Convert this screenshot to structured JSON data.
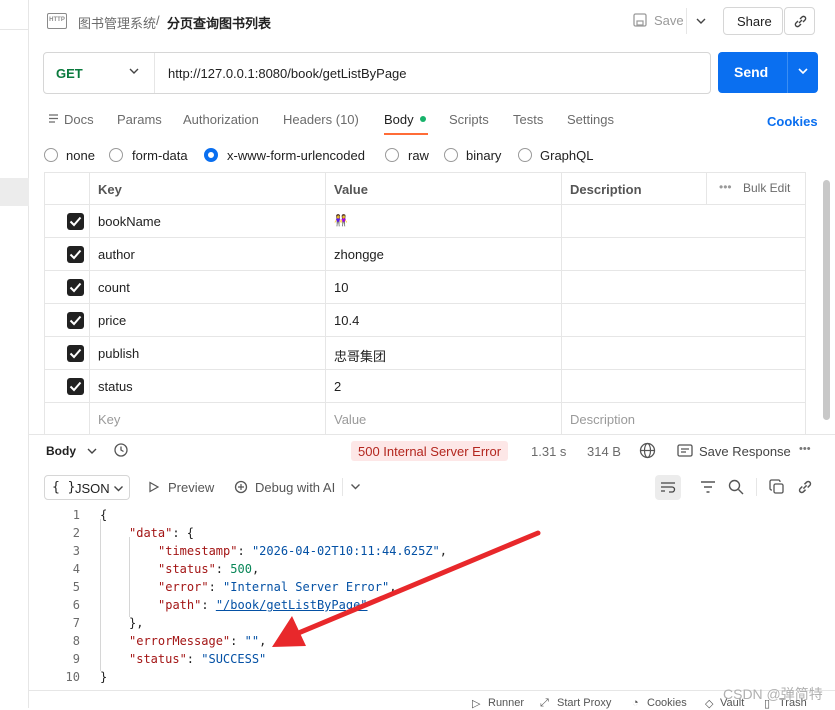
{
  "header": {
    "workspace": "图书管理系统",
    "separator": "/",
    "request_name": "分页查询图书列表",
    "save_label": "Save",
    "share_label": "Share"
  },
  "request": {
    "method": "GET",
    "url": "http://127.0.0.1:8080/book/getListByPage",
    "send_label": "Send"
  },
  "tabs": {
    "docs": "Docs",
    "params": "Params",
    "authorization": "Authorization",
    "headers": "Headers (10)",
    "body": "Body",
    "scripts": "Scripts",
    "tests": "Tests",
    "settings": "Settings",
    "cookies": "Cookies"
  },
  "body_types": {
    "none": "none",
    "form_data": "form-data",
    "urlencoded": "x-www-form-urlencoded",
    "raw": "raw",
    "binary": "binary",
    "graphql": "GraphQL",
    "selected": "x-www-form-urlencoded"
  },
  "table": {
    "headers": {
      "key": "Key",
      "value": "Value",
      "description": "Description",
      "bulk_edit": "Bulk Edit"
    },
    "rows": [
      {
        "key": "bookName",
        "value": "👭",
        "checked": true
      },
      {
        "key": "author",
        "value": "zhongge",
        "checked": true
      },
      {
        "key": "count",
        "value": "10",
        "checked": true
      },
      {
        "key": "price",
        "value": "10.4",
        "checked": true
      },
      {
        "key": "publish",
        "value": "忠哥集团",
        "checked": true
      },
      {
        "key": "status",
        "value": "2",
        "checked": true
      }
    ],
    "placeholder": {
      "key": "Key",
      "value": "Value",
      "description": "Description"
    }
  },
  "response": {
    "body_label": "Body",
    "status": "500 Internal Server Error",
    "time": "1.31 s",
    "size": "314 B",
    "save_response": "Save Response",
    "format": "JSON",
    "preview": "Preview",
    "debug": "Debug with AI"
  },
  "code_lines": {
    "l1": "{",
    "l2k": "\"data\"",
    "l2p": ": {",
    "l3k": "\"timestamp\"",
    "l3v": "\"2026-04-02T10:11:44.625Z\"",
    "l4k": "\"status\"",
    "l4v": "500",
    "l5k": "\"error\"",
    "l5v": "\"Internal Server Error\"",
    "l6k": "\"path\"",
    "l6v": "\"/book/getListByPage\"",
    "l7": "},",
    "l8k": "\"errorMessage\"",
    "l8v": "\"\"",
    "l9k": "\"status\"",
    "l9v": "\"SUCCESS\"",
    "l10": "}"
  },
  "bottom_bar": {
    "runner": "Runner",
    "start_proxy": "Start Proxy",
    "cookies": "Cookies",
    "vault": "Vault",
    "trash": "Trash"
  },
  "watermark": "CSDN @弹简特",
  "colors": {
    "accent": "#0a6ff0",
    "method": "#0a7a3d",
    "tab_underline": "#ff6c37",
    "error_badge_bg": "#fde7e7",
    "annotation_arrow": "#e8282b"
  }
}
